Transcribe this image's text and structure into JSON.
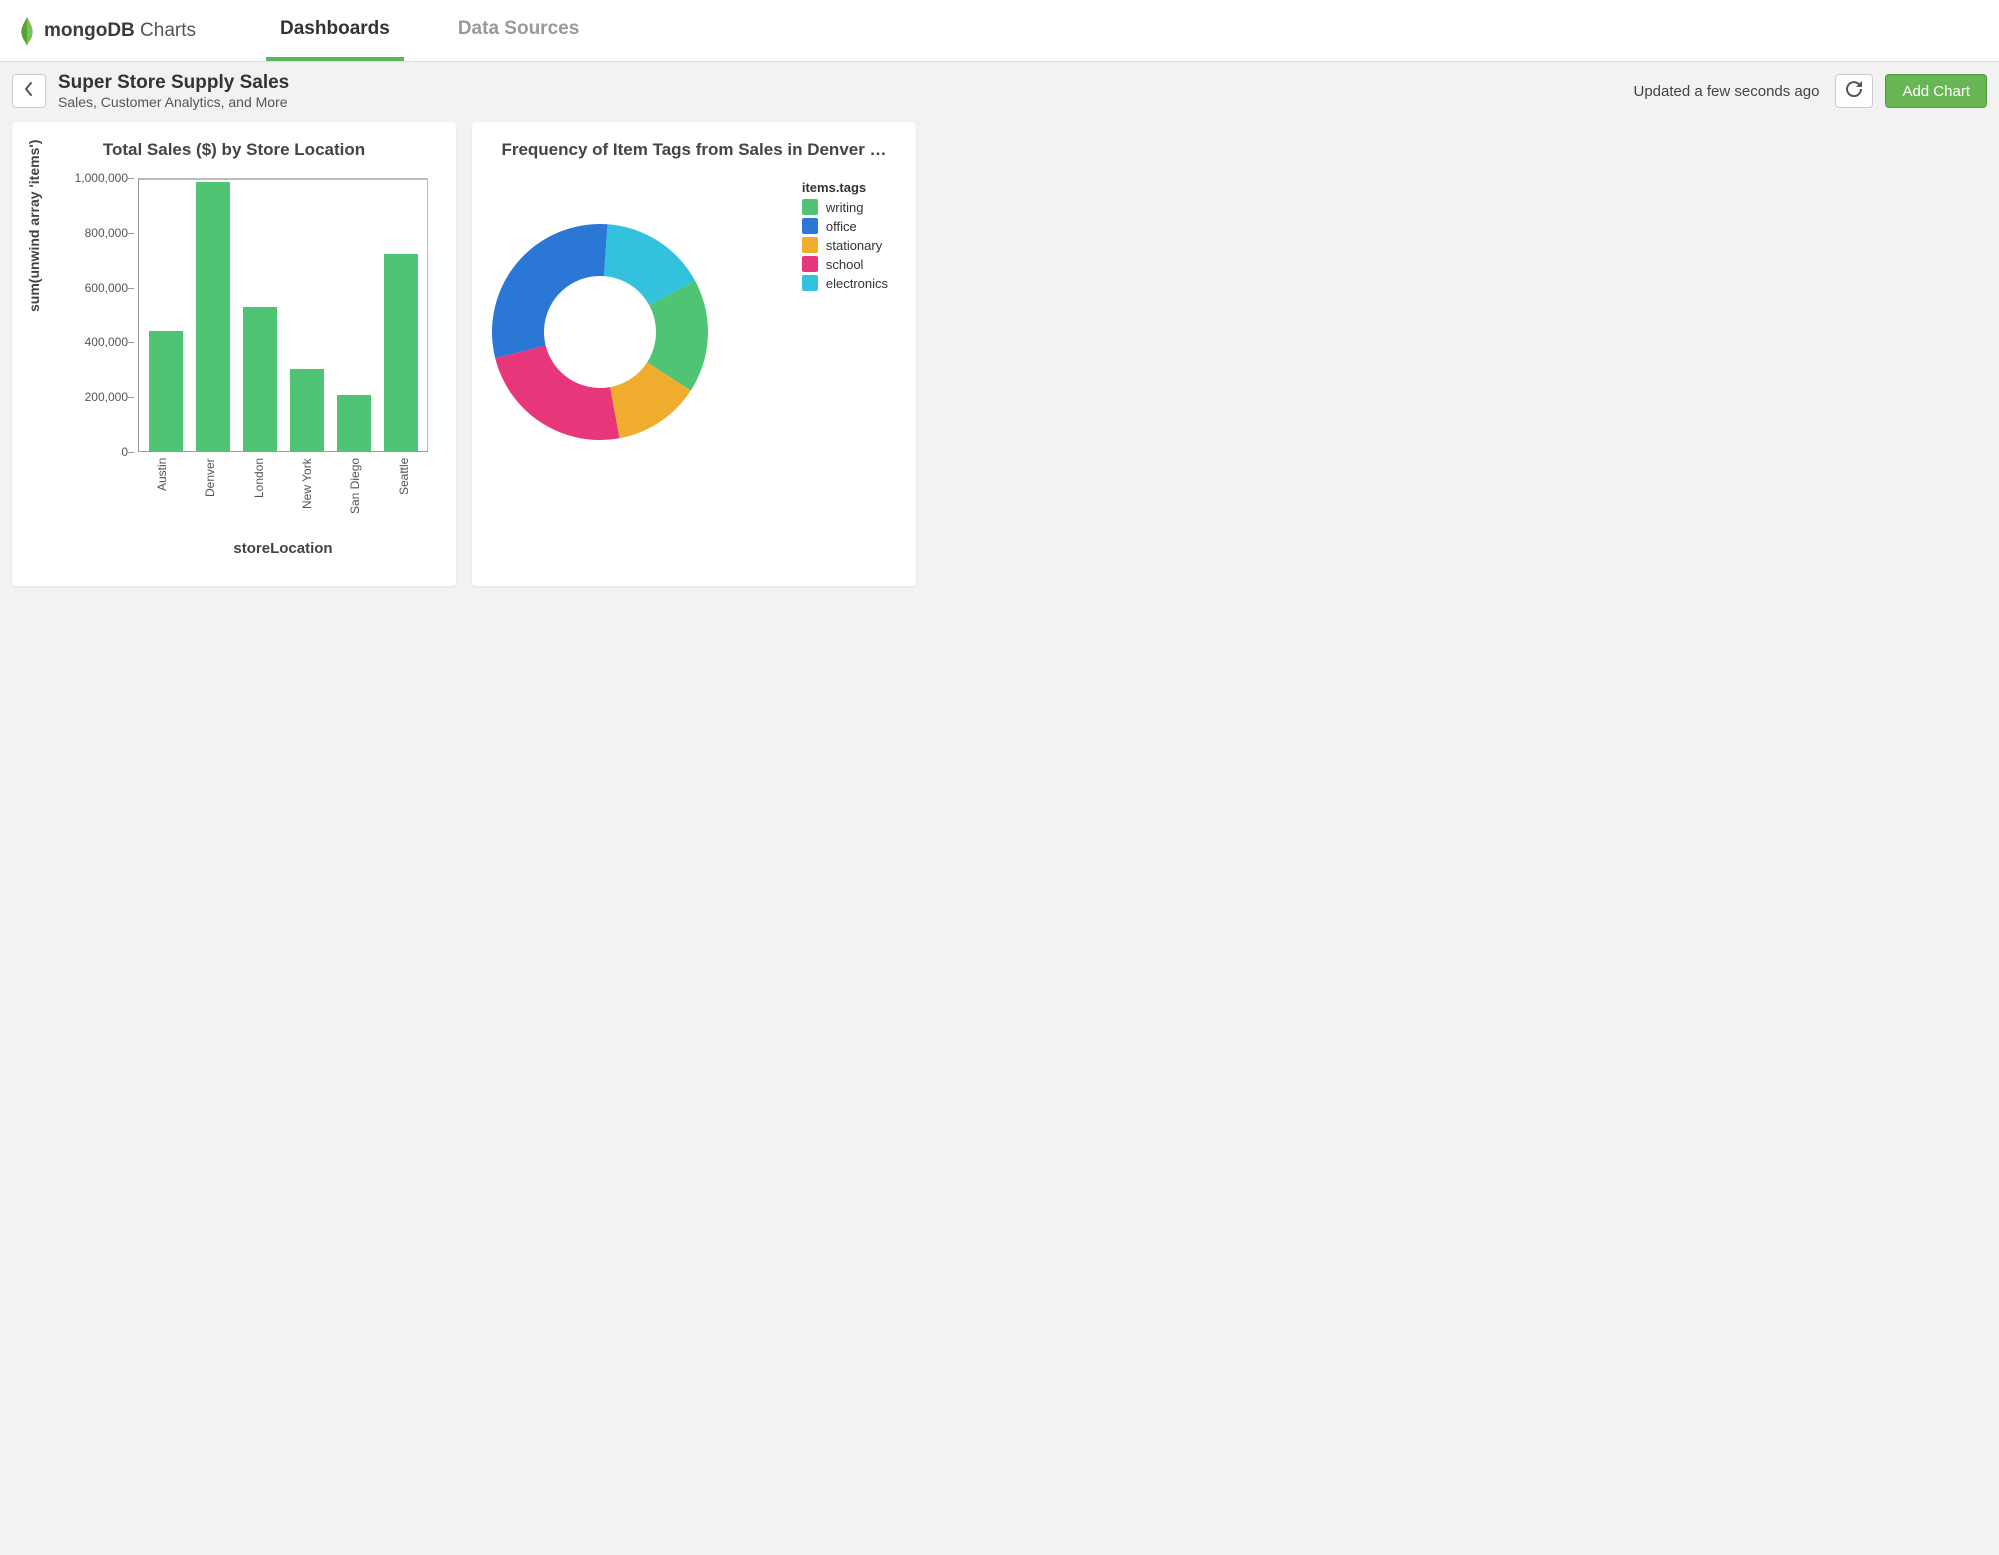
{
  "brand": {
    "bold": "mongoDB",
    "light": " Charts"
  },
  "nav": {
    "tabs": [
      "Dashboards",
      "Data Sources"
    ],
    "active_index": 0
  },
  "header": {
    "title": "Super Store Supply Sales",
    "subtitle": "Sales, Customer Analytics, and More",
    "updated": "Updated a few seconds ago",
    "add_button": "Add Chart"
  },
  "cards": {
    "bar": {
      "title": "Total Sales ($) by Store Location"
    },
    "donut": {
      "title": "Frequency of Item Tags from Sales in Denver …",
      "legend_title": "items.tags"
    }
  },
  "colors": {
    "bar": "#4fc475",
    "donut": {
      "writing": "#4fc475",
      "office": "#2b77d6",
      "stationary": "#f0ad2d",
      "school": "#e8367a",
      "electronics": "#33c2de"
    }
  },
  "chart_data": [
    {
      "type": "bar",
      "title": "Total Sales ($) by Store Location",
      "xlabel": "storeLocation",
      "ylabel": "sum(unwind array 'items')",
      "categories": [
        "Austin",
        "Denver",
        "London",
        "New York",
        "San Diego",
        "Seattle"
      ],
      "values": [
        440000,
        990000,
        530000,
        300000,
        205000,
        725000
      ],
      "ylim": [
        0,
        1000000
      ],
      "y_ticks": [
        0,
        200000,
        400000,
        600000,
        800000,
        1000000
      ],
      "y_tick_labels": [
        "0",
        "200,000",
        "400,000",
        "600,000",
        "800,000",
        "1,000,000"
      ]
    },
    {
      "type": "pie",
      "title": "Frequency of Item Tags from Sales in Denver …",
      "legend_title": "items.tags",
      "series": [
        {
          "name": "writing",
          "value": 17,
          "color": "#4fc475"
        },
        {
          "name": "office",
          "value": 30,
          "color": "#2b77d6"
        },
        {
          "name": "stationary",
          "value": 13,
          "color": "#f0ad2d"
        },
        {
          "name": "school",
          "value": 24,
          "color": "#e8367a"
        },
        {
          "name": "electronics",
          "value": 16,
          "color": "#33c2de"
        }
      ]
    }
  ]
}
